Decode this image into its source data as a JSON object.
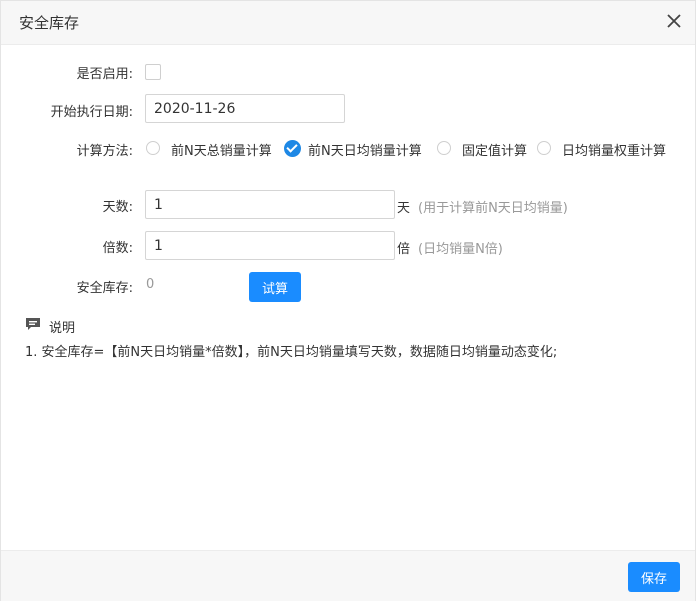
{
  "dialog": {
    "title": "安全库存",
    "close_icon": "close-icon"
  },
  "form": {
    "enable_label": "是否启用:",
    "enable_checked": false,
    "start_date_label": "开始执行日期:",
    "start_date_value": "2020-11-26",
    "method_label": "计算方法:",
    "methods": [
      {
        "label": "前N天总销量计算",
        "checked": false
      },
      {
        "label": "前N天日均销量计算",
        "checked": true
      },
      {
        "label": "固定值计算",
        "checked": false
      },
      {
        "label": "日均销量权重计算",
        "checked": false
      }
    ],
    "days_label": "天数:",
    "days_value": "1",
    "days_unit": "天",
    "days_hint": "(用于计算前N天日均销量)",
    "multiple_label": "倍数:",
    "multiple_value": "1",
    "multiple_unit": "倍",
    "multiple_hint": "(日均销量N倍)",
    "safety_stock_label": "安全库存:",
    "safety_stock_value": "0",
    "calc_button": "试算"
  },
  "notes": {
    "icon": "comment-icon",
    "title": "说明",
    "lines": [
      "1. 安全库存=【前N天日均销量*倍数】，前N天日均销量填写天数，数据随日均销量动态变化;"
    ]
  },
  "footer": {
    "save_button": "保存"
  },
  "colors": {
    "primary": "#1a8cff",
    "header_bg": "#f7f7f7"
  }
}
